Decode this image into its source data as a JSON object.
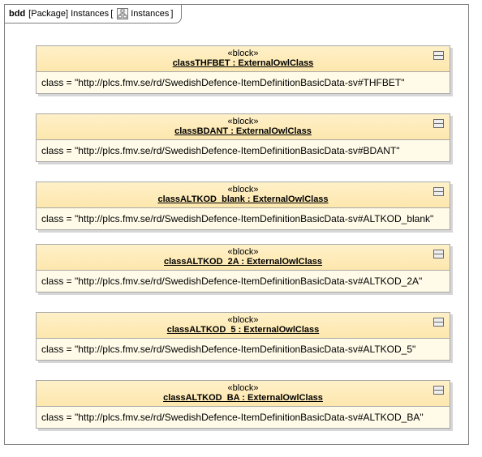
{
  "frame": {
    "kind": "bdd",
    "package": "[Package]",
    "name": "Instances",
    "open_bracket": "[",
    "diagram_label": "Instances",
    "close_bracket": "]"
  },
  "blocks": [
    {
      "stereotype": "«block»",
      "name": "classTHFBET : ExternalOwlClass",
      "slot": "class = \"http://plcs.fmv.se/rd/SwedishDefence-ItemDefinitionBasicData-sv#THFBET\""
    },
    {
      "stereotype": "«block»",
      "name": "classBDANT : ExternalOwlClass",
      "slot": "class = \"http://plcs.fmv.se/rd/SwedishDefence-ItemDefinitionBasicData-sv#BDANT\""
    },
    {
      "stereotype": "«block»",
      "name": "classALTKOD_blank : ExternalOwlClass",
      "slot": "class = \"http://plcs.fmv.se/rd/SwedishDefence-ItemDefinitionBasicData-sv#ALTKOD_blank\""
    },
    {
      "stereotype": "«block»",
      "name": "classALTKOD_2A : ExternalOwlClass",
      "slot": "class = \"http://plcs.fmv.se/rd/SwedishDefence-ItemDefinitionBasicData-sv#ALTKOD_2A\""
    },
    {
      "stereotype": "«block»",
      "name": "classALTKOD_5 : ExternalOwlClass",
      "slot": "class = \"http://plcs.fmv.se/rd/SwedishDefence-ItemDefinitionBasicData-sv#ALTKOD_5\""
    },
    {
      "stereotype": "«block»",
      "name": "classALTKOD_BA : ExternalOwlClass",
      "slot": "class = \"http://plcs.fmv.se/rd/SwedishDefence-ItemDefinitionBasicData-sv#ALTKOD_BA\""
    }
  ],
  "icons": {
    "diagram": "bdd-diagram-icon",
    "block": "compartment-toggle-icon"
  },
  "colors": {
    "block_header_top": "#fef0c8",
    "block_header_bottom": "#fde7ad",
    "block_body": "#fffbe8",
    "border": "#a8a8a8"
  }
}
